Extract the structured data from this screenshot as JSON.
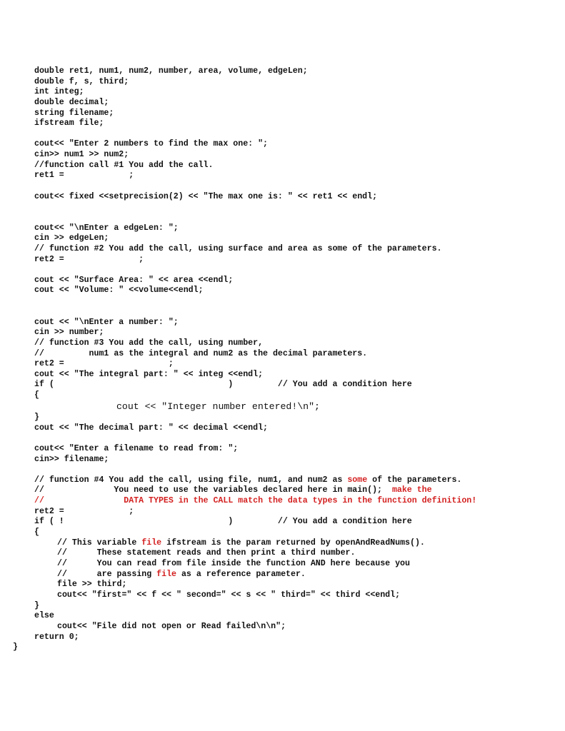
{
  "document": {
    "kind": "C++ source code listing (main function body)",
    "accent_color": "#d42020",
    "lines": [
      {
        "id": "l1",
        "text": "double ret1, num1, num2, number, area, volume, edgeLen;"
      },
      {
        "id": "l2",
        "text": "double f, s, third;"
      },
      {
        "id": "l3",
        "text": "int integ;"
      },
      {
        "id": "l4",
        "text": "double decimal;"
      },
      {
        "id": "l5",
        "text": "string filename;"
      },
      {
        "id": "l6",
        "text": "ifstream file;"
      },
      {
        "id": "l7",
        "text": "cout<< \"Enter 2 numbers to find the max one: \";"
      },
      {
        "id": "l8",
        "text": "cin>> num1 >> num2;"
      },
      {
        "id": "l9",
        "text": "//function call #1 You add the call."
      },
      {
        "id": "l10",
        "text": "ret1 =             ;"
      },
      {
        "id": "l11",
        "text": "cout<< fixed <<setprecision(2) << \"The max one is: \" << ret1 << endl;"
      },
      {
        "id": "l12",
        "text": "cout<< \"\\nEnter a edgeLen: \";"
      },
      {
        "id": "l13",
        "text": "cin >> edgeLen;"
      },
      {
        "id": "l14",
        "text": "// function #2 You add the call, using surface and area as some of the parameters."
      },
      {
        "id": "l15",
        "text": "ret2 =               ;"
      },
      {
        "id": "l16",
        "text": "cout << \"Surface Area: \" << area <<endl;"
      },
      {
        "id": "l17",
        "text": "cout << \"Volume: \" <<volume<<endl;"
      },
      {
        "id": "l18",
        "text": "cout << \"\\nEnter a number: \";"
      },
      {
        "id": "l19",
        "text": "cin >> number;"
      },
      {
        "id": "l20",
        "text": "// function #3 You add the call, using number,"
      },
      {
        "id": "l21",
        "text": "//         num1 as the integral and num2 as the decimal parameters."
      },
      {
        "id": "l22",
        "text": "ret2 =                     ;"
      },
      {
        "id": "l23",
        "text": "cout << \"The integral part: \" << integ <<endl;"
      },
      {
        "id": "l24",
        "text": "if (                                   )         // You add a condition here"
      },
      {
        "id": "l25",
        "text": "{"
      },
      {
        "id": "l26",
        "text": "cout << \"Integer number entered!\\n\";"
      },
      {
        "id": "l27",
        "text": "}"
      },
      {
        "id": "l28",
        "text": "cout << \"The decimal part: \" << decimal <<endl;"
      },
      {
        "id": "l29",
        "text": "cout<< \"Enter a filename to read from: \";"
      },
      {
        "id": "l30",
        "text": "cin>> filename;"
      },
      {
        "id": "l31a",
        "text": "// function #4 You add the call, using file, num1, and num2 as "
      },
      {
        "id": "l31b",
        "text": "some"
      },
      {
        "id": "l31c",
        "text": " of the parameters."
      },
      {
        "id": "l32a",
        "text": "//              You need to use the variables declared here in main();  "
      },
      {
        "id": "l32b",
        "text": "make the"
      },
      {
        "id": "l33a",
        "text": "//"
      },
      {
        "id": "l33b",
        "text": "                DATA TYPES in the CALL match the data types in the function definition!"
      },
      {
        "id": "l34",
        "text": "ret2 =             ;"
      },
      {
        "id": "l35",
        "text": "if ( !                                 )         // You add a condition here"
      },
      {
        "id": "l36",
        "text": "{"
      },
      {
        "id": "l37a",
        "text": "// This variable "
      },
      {
        "id": "l37b",
        "text": "file"
      },
      {
        "id": "l37c",
        "text": " ifstream is the param returned by openAndReadNums()."
      },
      {
        "id": "l38",
        "text": "//      These statement reads and then print a third number."
      },
      {
        "id": "l39",
        "text": "//      You can read from file inside the function AND here because you"
      },
      {
        "id": "l40a",
        "text": "//      are passing "
      },
      {
        "id": "l40b",
        "text": "file"
      },
      {
        "id": "l40c",
        "text": " as a reference parameter."
      },
      {
        "id": "l41",
        "text": "file >> third;"
      },
      {
        "id": "l42",
        "text": "cout<< \"first=\" << f << \" second=\" << s << \" third=\" << third <<endl;"
      },
      {
        "id": "l43",
        "text": "}"
      },
      {
        "id": "l44",
        "text": "else"
      },
      {
        "id": "l45",
        "text": "cout<< \"File did not open or Read failed\\n\\n\";"
      },
      {
        "id": "l46",
        "text": "return 0;"
      },
      {
        "id": "l47",
        "text": "}"
      }
    ]
  }
}
